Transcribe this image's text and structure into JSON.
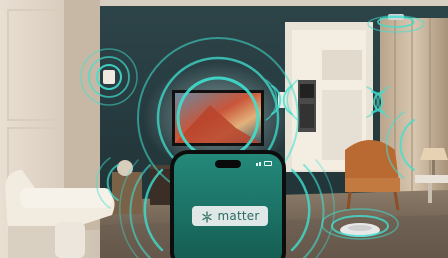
{
  "scene": {
    "accent_color": "#3fe0d0",
    "phone_screen_color": "#1f7a6c",
    "wall_color": "#24383d"
  },
  "phone": {
    "badge_icon": "matter-logo-icon",
    "badge_label": "matter"
  }
}
